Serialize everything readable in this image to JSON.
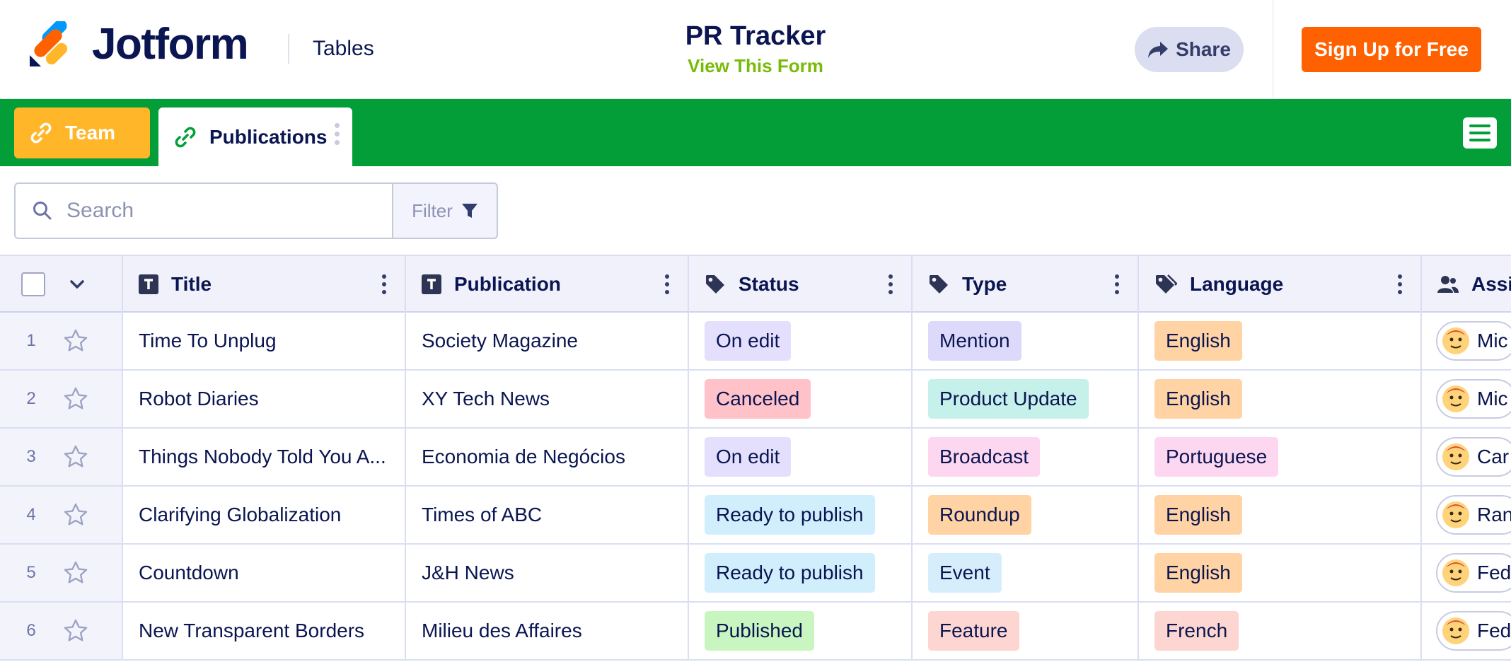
{
  "header": {
    "brand": "Jotform",
    "product": "Tables",
    "form_title": "PR Tracker",
    "form_link": "View This Form",
    "share_label": "Share",
    "signup_label": "Sign Up for Free"
  },
  "tabs": [
    {
      "label": "Team",
      "icon": "link-icon",
      "color": "#ffb629"
    },
    {
      "label": "Publications",
      "icon": "link-icon",
      "active": true
    }
  ],
  "toolbar": {
    "search_placeholder": "Search",
    "filter_label": "Filter"
  },
  "columns": [
    {
      "label": "Title",
      "icon": "text-field-icon"
    },
    {
      "label": "Publication",
      "icon": "text-field-icon"
    },
    {
      "label": "Status",
      "icon": "tag-icon"
    },
    {
      "label": "Type",
      "icon": "tag-icon"
    },
    {
      "label": "Language",
      "icon": "tags-icon"
    },
    {
      "label": "Assi",
      "icon": "assignee-icon"
    }
  ],
  "rows": [
    {
      "num": "1",
      "title": "Time To Unplug",
      "publication": "Society Magazine",
      "status": {
        "text": "On edit",
        "color": "#e3dffd"
      },
      "type": {
        "text": "Mention",
        "color": "#ddd9fb"
      },
      "language": {
        "text": "English",
        "color": "#ffd3a3"
      },
      "assignee": "Mic"
    },
    {
      "num": "2",
      "title": "Robot Diaries",
      "publication": "XY Tech News",
      "status": {
        "text": "Canceled",
        "color": "#ffc2c9"
      },
      "type": {
        "text": "Product Update",
        "color": "#c6f0ea"
      },
      "language": {
        "text": "English",
        "color": "#ffd3a3"
      },
      "assignee": "Mic"
    },
    {
      "num": "3",
      "title": "Things Nobody Told You A...",
      "publication": "Economia de Negócios",
      "status": {
        "text": "On edit",
        "color": "#e3dffd"
      },
      "type": {
        "text": "Broadcast",
        "color": "#fdd7f0"
      },
      "language": {
        "text": "Portuguese",
        "color": "#fdd7f0"
      },
      "assignee": "Car"
    },
    {
      "num": "4",
      "title": "Clarifying Globalization",
      "publication": "Times of ABC",
      "status": {
        "text": "Ready to publish",
        "color": "#d1eefc"
      },
      "type": {
        "text": "Roundup",
        "color": "#ffd3a3"
      },
      "language": {
        "text": "English",
        "color": "#ffd3a3"
      },
      "assignee": "Ran"
    },
    {
      "num": "5",
      "title": "Countdown",
      "publication": "J&H News",
      "status": {
        "text": "Ready to publish",
        "color": "#d1eefc"
      },
      "type": {
        "text": "Event",
        "color": "#d6eefc"
      },
      "language": {
        "text": "English",
        "color": "#ffd3a3"
      },
      "assignee": "Fed"
    },
    {
      "num": "6",
      "title": "New Transparent Borders",
      "publication": "Milieu des Affaires",
      "status": {
        "text": "Published",
        "color": "#c9f6c0"
      },
      "type": {
        "text": "Feature",
        "color": "#fed6d1"
      },
      "language": {
        "text": "French",
        "color": "#fed6d1"
      },
      "assignee": "Fed"
    }
  ],
  "colors": {
    "brand_green": "#049e38",
    "signup_orange": "#ff6100",
    "link_green": "#78bb07",
    "navy": "#0a1551"
  }
}
